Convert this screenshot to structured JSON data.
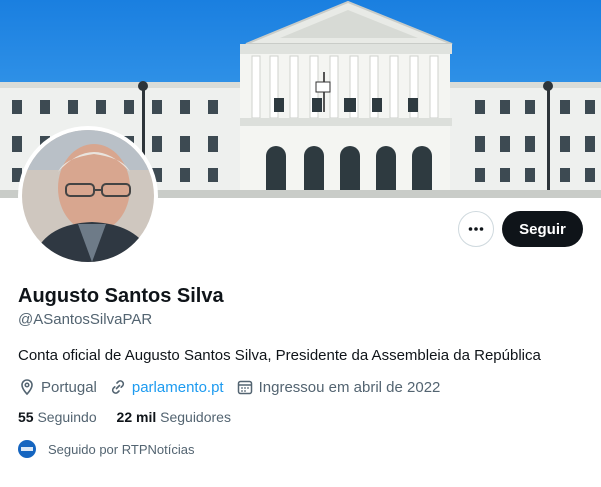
{
  "profile": {
    "name": "Augusto Santos Silva",
    "handle": "@ASantosSilvaPAR",
    "bio": "Conta oficial de Augusto Santos Silva, Presidente da Assembleia da República",
    "location": "Portugal",
    "website": "parlamento.pt",
    "joined": "Ingressou em abril de 2022"
  },
  "stats": {
    "following_count": "55",
    "following_label": "Seguindo",
    "followers_count": "22 mil",
    "followers_label": "Seguidores"
  },
  "followed_by": "Seguido por RTPNotícias",
  "actions": {
    "follow_label": "Seguir"
  },
  "icons": [
    "more-icon",
    "location-icon",
    "link-icon",
    "calendar-icon"
  ],
  "colors": {
    "accent": "#1d9bf0",
    "primary_button": "#0f1419",
    "muted": "#536471"
  }
}
